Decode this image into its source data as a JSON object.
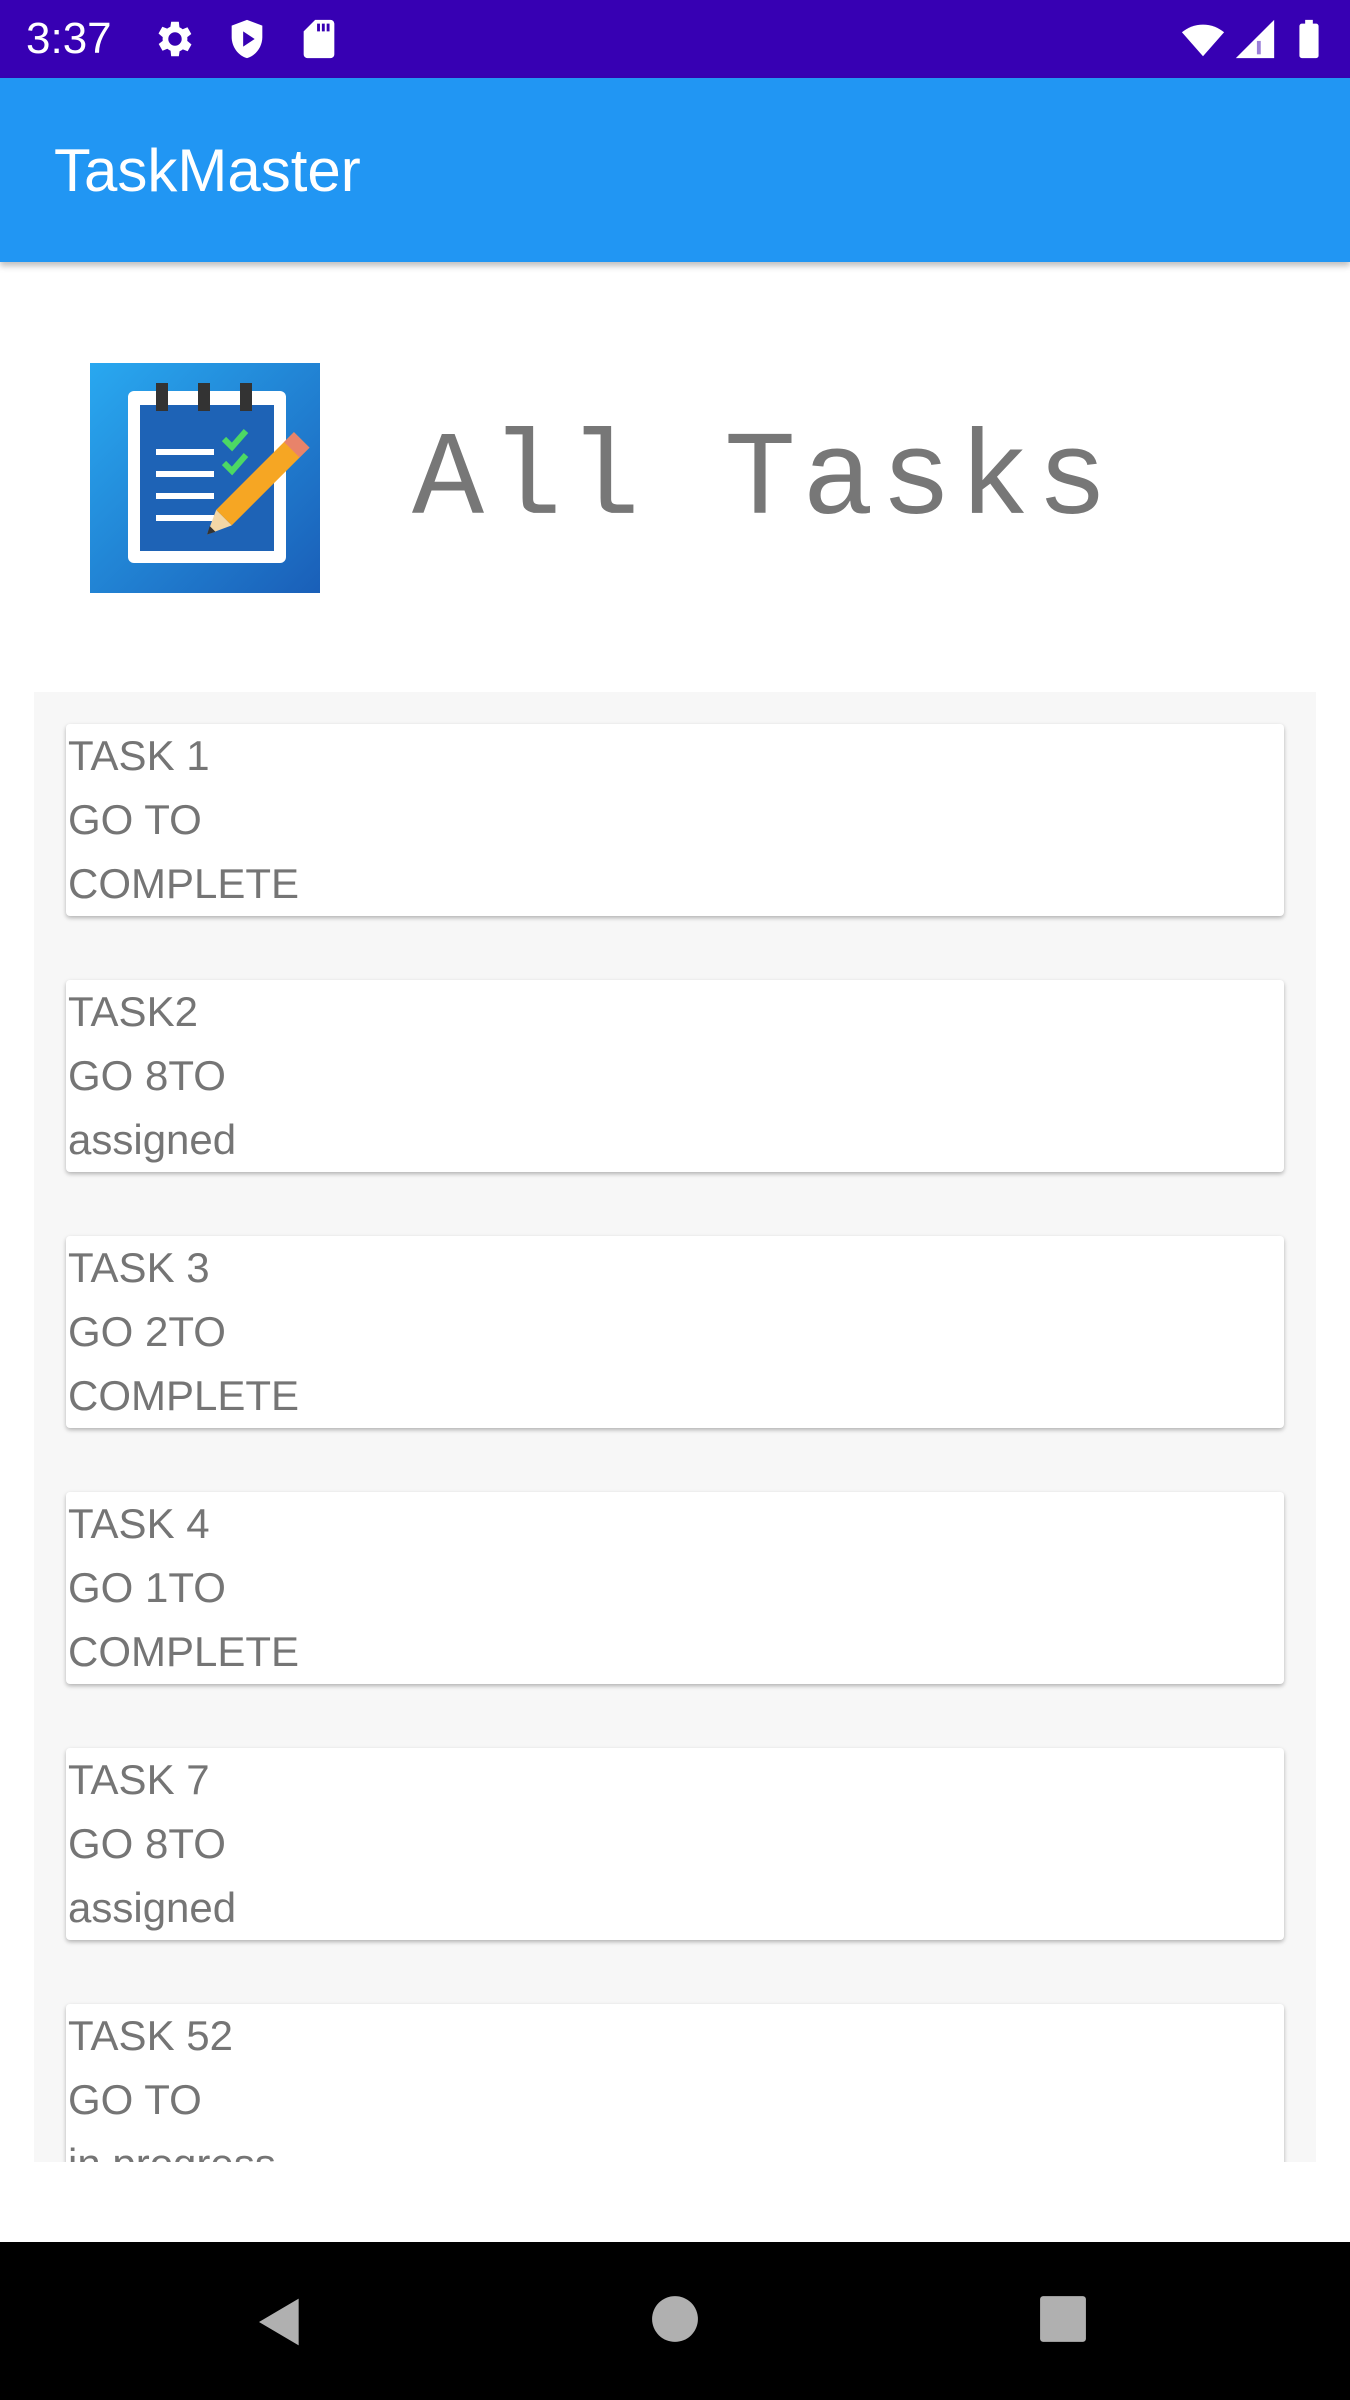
{
  "status_bar": {
    "time": "3:37",
    "icons_left": [
      "gear-icon",
      "shield-play-icon",
      "sd-card-icon"
    ],
    "icons_right": [
      "wifi-icon",
      "cell-signal-icon",
      "battery-icon"
    ],
    "color": "#3700b3"
  },
  "app_bar": {
    "title": "TaskMaster",
    "color": "#2196f3"
  },
  "header": {
    "logo_icon": "clipboard-checklist-pencil-icon",
    "title": "All Tasks"
  },
  "tasks": [
    {
      "title": "TASK 1",
      "body": "GO TO",
      "state": "COMPLETE"
    },
    {
      "title": "TASK2",
      "body": "GO 8TO",
      "state": "assigned"
    },
    {
      "title": "TASK 3",
      "body": "GO 2TO",
      "state": "COMPLETE"
    },
    {
      "title": "TASK 4",
      "body": "GO 1TO",
      "state": "COMPLETE"
    },
    {
      "title": "TASK 7",
      "body": "GO 8TO",
      "state": "assigned"
    },
    {
      "title": "TASK 52",
      "body": "GO TO",
      "state": "in progress"
    }
  ],
  "nav_bar": {
    "icons": [
      "back-icon",
      "home-icon",
      "recents-icon"
    ]
  }
}
